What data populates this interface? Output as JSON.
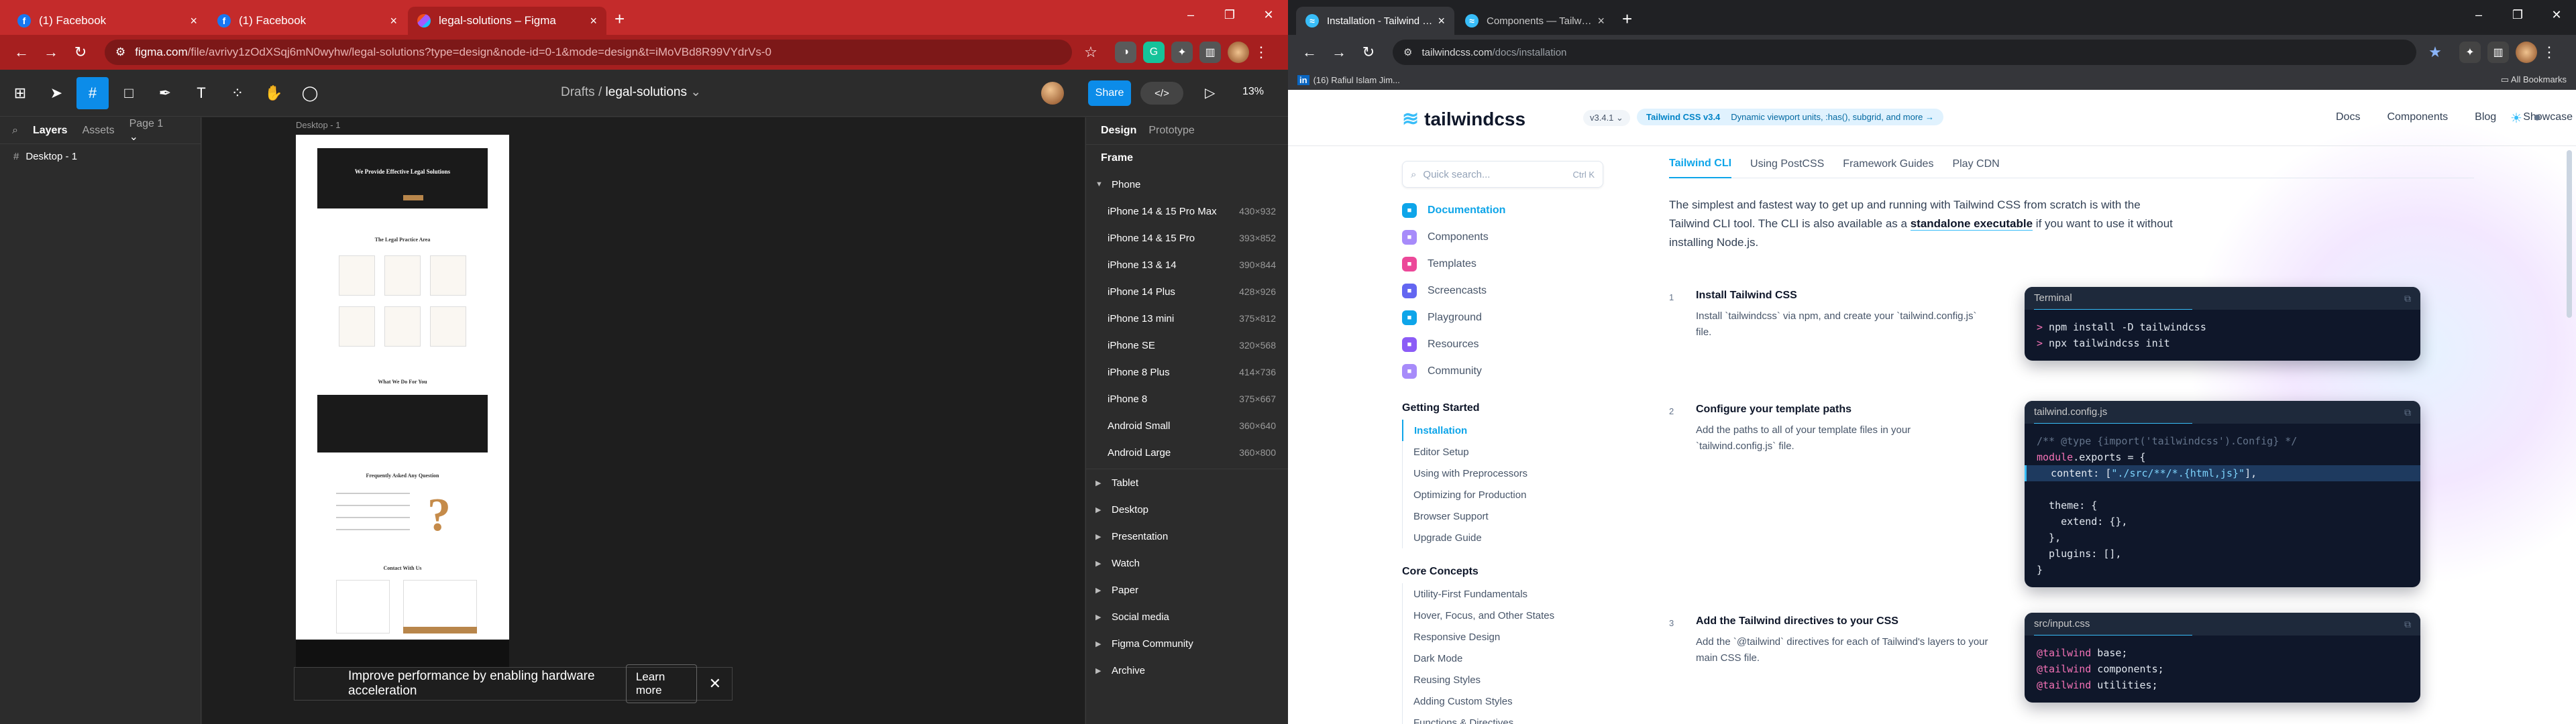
{
  "left_browser": {
    "tabs": [
      {
        "title": "(1) Facebook",
        "icon": "facebook-icon"
      },
      {
        "title": "(1) Facebook",
        "icon": "facebook-icon"
      },
      {
        "title": "legal-solutions – Figma",
        "icon": "figma-icon",
        "active": true
      }
    ],
    "url_host": "figma.com",
    "url_path": "/file/avrivy1zOdXSqj6mN0wyhw/legal-solutions?type=design&node-id=0-1&mode=design&t=iMoVBd8R99VYdrVs-0",
    "accent": "#c42b2b"
  },
  "figma": {
    "breadcrumb_parent": "Drafts",
    "file_name": "legal-solutions",
    "share_label": "Share",
    "zoom": "13%",
    "left_tabs": {
      "layers": "Layers",
      "assets": "Assets",
      "page": "Page 1"
    },
    "layers": [
      "Desktop - 1"
    ],
    "frame_label": "Desktop - 1",
    "frame_content": {
      "hero_title": "We Provide Effective Legal Solutions",
      "practice_title": "The Legal Practice Area",
      "what_title": "What We Do For You",
      "faq_title": "Frequently Asked Any Question",
      "contact_title": "Contact With Us"
    },
    "toast_text": "Improve performance by enabling hardware acceleration",
    "toast_action": "Learn more",
    "right_tabs": {
      "design": "Design",
      "prototype": "Prototype"
    },
    "panel_title": "Frame",
    "groups_open": "Phone",
    "devices": [
      {
        "name": "iPhone 14 & 15 Pro Max",
        "size": "430×932"
      },
      {
        "name": "iPhone 14 & 15 Pro",
        "size": "393×852"
      },
      {
        "name": "iPhone 13 & 14",
        "size": "390×844"
      },
      {
        "name": "iPhone 14 Plus",
        "size": "428×926"
      },
      {
        "name": "iPhone 13 mini",
        "size": "375×812"
      },
      {
        "name": "iPhone SE",
        "size": "320×568"
      },
      {
        "name": "iPhone 8 Plus",
        "size": "414×736"
      },
      {
        "name": "iPhone 8",
        "size": "375×667"
      },
      {
        "name": "Android Small",
        "size": "360×640"
      },
      {
        "name": "Android Large",
        "size": "360×800"
      }
    ],
    "groups": [
      "Tablet",
      "Desktop",
      "Presentation",
      "Watch",
      "Paper",
      "Social media",
      "Figma Community",
      "Archive"
    ]
  },
  "right_browser": {
    "tabs": [
      {
        "title": "Installation - Tailwind CSS",
        "icon": "tailwind-icon",
        "active": true
      },
      {
        "title": "Components — Tailwind CSS",
        "icon": "tailwind-icon"
      }
    ],
    "url_host": "tailwindcss.com",
    "url_path": "/docs/installation",
    "bookmark": "(16) Rafiul Islam Jim...",
    "all_bookmarks": "All Bookmarks"
  },
  "tailwind": {
    "logo": "tailwindcss",
    "version": "v3.4.1",
    "announce_bold": "Tailwind CSS v3.4",
    "announce_rest": "Dynamic viewport units, :has(), subgrid, and more",
    "nav": [
      "Docs",
      "Components",
      "Blog",
      "Showcase"
    ],
    "search_placeholder": "Quick search...",
    "search_kbd": "Ctrl K",
    "primary_nav": [
      {
        "label": "Documentation",
        "color": "#0ea5e9",
        "active": true
      },
      {
        "label": "Components",
        "color": "#a78bfa"
      },
      {
        "label": "Templates",
        "color": "#ec4899"
      },
      {
        "label": "Screencasts",
        "color": "#6366f1"
      },
      {
        "label": "Playground",
        "color": "#0ea5e9"
      },
      {
        "label": "Resources",
        "color": "#8b5cf6"
      },
      {
        "label": "Community",
        "color": "#a78bfa"
      }
    ],
    "getting_started_title": "Getting Started",
    "getting_started": [
      "Installation",
      "Editor Setup",
      "Using with Preprocessors",
      "Optimizing for Production",
      "Browser Support",
      "Upgrade Guide"
    ],
    "core_concepts_title": "Core Concepts",
    "core_concepts": [
      "Utility-First Fundamentals",
      "Hover, Focus, and Other States",
      "Responsive Design",
      "Dark Mode",
      "Reusing Styles",
      "Adding Custom Styles",
      "Functions & Directives"
    ],
    "content_tabs": [
      "Tailwind CLI",
      "Using PostCSS",
      "Framework Guides",
      "Play CDN"
    ],
    "intro_1": "The simplest and fastest way to get up and running with Tailwind CSS from scratch is with the Tailwind CLI tool. The CLI is also available as a ",
    "intro_link": "standalone executable",
    "intro_2": " if you want to use it without installing Node.js.",
    "steps": [
      {
        "num": "1",
        "title": "Install Tailwind CSS",
        "desc": "Install `tailwindcss` via npm, and create your `tailwind.config.js` file.",
        "file": "Terminal"
      },
      {
        "num": "2",
        "title": "Configure your template paths",
        "desc": "Add the paths to all of your template files in your `tailwind.config.js` file.",
        "file": "tailwind.config.js"
      },
      {
        "num": "3",
        "title": "Add the Tailwind directives to your CSS",
        "desc": "Add the `@tailwind` directives for each of Tailwind's layers to your main CSS file.",
        "file": "src/input.css"
      }
    ],
    "code1": [
      "> npm install -D tailwindcss",
      "> npx tailwindcss init"
    ],
    "code2": [
      "/** @type {import('tailwindcss').Config} */",
      "module.exports = {",
      "  content: [\"./src/**/*.{html,js}\"],",
      "  theme: {",
      "    extend: {},",
      "  },",
      "  plugins: [],",
      "}"
    ],
    "code3": [
      "@tailwind base;",
      "@tailwind components;",
      "@tailwind utilities;"
    ]
  }
}
